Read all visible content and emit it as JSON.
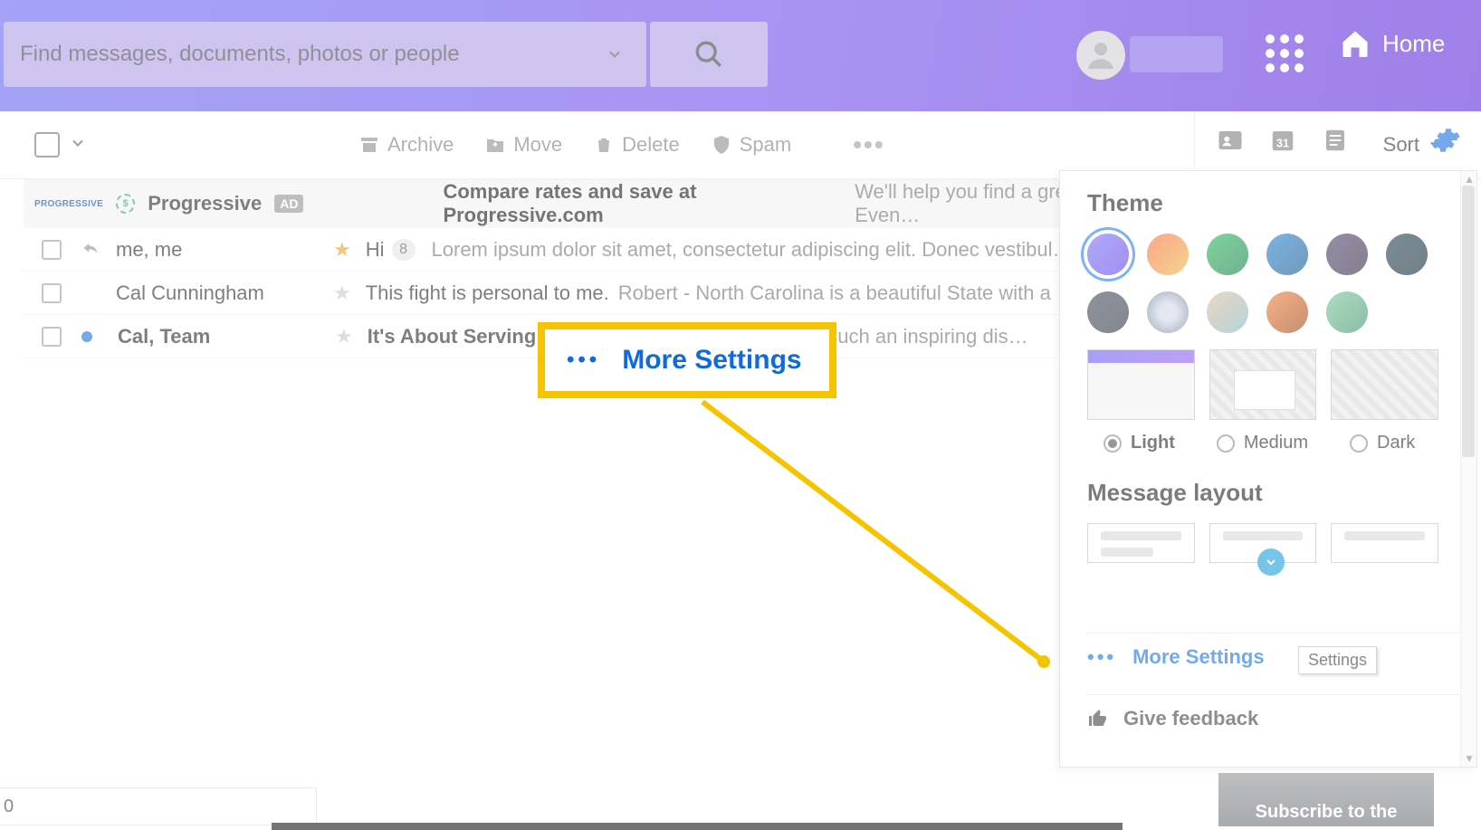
{
  "header": {
    "search": {
      "placeholder": "Find messages, documents, photos or people"
    },
    "home_label": "Home"
  },
  "toolbar": {
    "archive": "Archive",
    "move": "Move",
    "delete": "Delete",
    "spam": "Spam",
    "sort": "Sort"
  },
  "ad": {
    "brand_tiny": "PROGRESSIVE",
    "name": "Progressive",
    "tag": "AD",
    "subject": "Compare rates and save at Progressive.com",
    "preview": "We'll help you find a great rate. Even…"
  },
  "messages": [
    {
      "sender": "me, me",
      "bold_sender": false,
      "replied": true,
      "unread_dot": false,
      "starred": true,
      "subject": "Hi",
      "bold_subject": false,
      "count": "8",
      "preview": "Lorem ipsum dolor sit amet, consectetur adipiscing elit. Donec vestibul…"
    },
    {
      "sender": "Cal Cunningham",
      "bold_sender": false,
      "replied": false,
      "unread_dot": false,
      "starred": false,
      "subject": "This fight is personal to me.",
      "bold_subject": false,
      "count": "",
      "preview": "Robert - North Carolina is a beautiful State with a …"
    },
    {
      "sender": "Cal, Team",
      "bold_sender": true,
      "replied": false,
      "unread_dot": true,
      "starred": false,
      "subject": "It's About Serving C",
      "bold_subject": true,
      "count": "",
      "preview": "such an inspiring dis…"
    }
  ],
  "callout": {
    "label": "More Settings"
  },
  "panel": {
    "theme_header": "Theme",
    "layout_header": "Message layout",
    "color_swatches_row1": [
      "linear-gradient(135deg,#7a6af4,#5a3fe6)",
      "linear-gradient(135deg,#f2683a,#f0b23a)",
      "linear-gradient(135deg,#1fb25a,#0c7a3e)",
      "linear-gradient(135deg,#1a7ed0,#0b4f86)",
      "linear-gradient(135deg,#4b3a63,#2c2340)",
      "linear-gradient(135deg,#1b3a4a,#0e2430)"
    ],
    "color_swatches_row2": [
      "linear-gradient(135deg,#3b4454,#2a3140)",
      "radial-gradient(circle,#cfd8e6 30%,#5b6e86)",
      "linear-gradient(135deg,#d9b99a,#7fb4c0)",
      "linear-gradient(135deg,#f07a2a,#9b3d12)",
      "linear-gradient(135deg,#6fc490,#3a8e66)"
    ],
    "modes": {
      "light": "Light",
      "medium": "Medium",
      "dark": "Dark",
      "selected": "light"
    },
    "more_settings": "More Settings",
    "give_feedback": "Give feedback",
    "tooltip": "Settings"
  },
  "sub_banner": "Subscribe to the",
  "bottom_left_label": "0"
}
